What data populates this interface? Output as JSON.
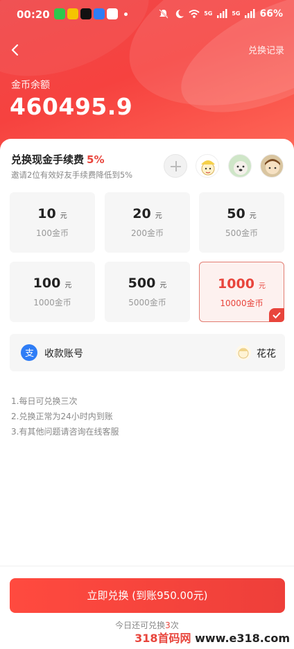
{
  "status_bar": {
    "time": "00:20",
    "battery": "66%",
    "signal1": "5G",
    "signal2": "5G"
  },
  "header": {
    "records_label": "兑换记录"
  },
  "balance": {
    "label": "金币余额",
    "value": "460495.9"
  },
  "fee": {
    "title": "兑换现金手续费",
    "percent": "5%",
    "subtitle": "邀请2位有效好友手续费降低到5%"
  },
  "tiles": [
    {
      "amount": "10",
      "unit": "元",
      "coins": "100金币"
    },
    {
      "amount": "20",
      "unit": "元",
      "coins": "200金币"
    },
    {
      "amount": "50",
      "unit": "元",
      "coins": "500金币"
    },
    {
      "amount": "100",
      "unit": "元",
      "coins": "1000金币"
    },
    {
      "amount": "500",
      "unit": "元",
      "coins": "5000金币"
    },
    {
      "amount": "1000",
      "unit": "元",
      "coins": "10000金币",
      "selected": true
    }
  ],
  "account": {
    "label": "收款账号",
    "name": "花花"
  },
  "rules": [
    "1.每日可兑换三次",
    "2.兑换正常为24小时内到账",
    "3.有其他问题请咨询在线客服"
  ],
  "cta": {
    "label": "立即兑换 (到账950.00元)"
  },
  "remaining": {
    "prefix": "今日还可兑换",
    "count": "3",
    "suffix": "次"
  },
  "watermark": {
    "red": "318首码网",
    "dark": " www.e318.com"
  },
  "colors": {
    "accent": "#e8453c",
    "hero": "#f6423f",
    "alipay": "#2f7df6"
  }
}
